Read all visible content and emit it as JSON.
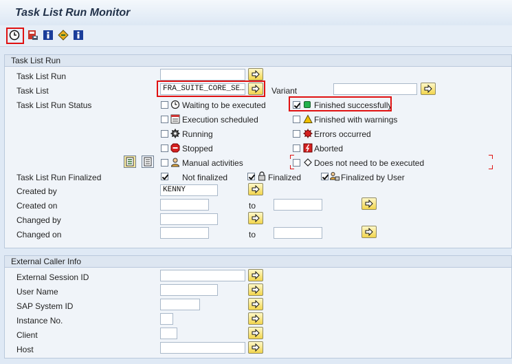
{
  "title": "Task List Run Monitor",
  "colors": {
    "highlight": "#e01010",
    "success": "#22b14c",
    "error": "#d42020",
    "warning": "#f0c000"
  },
  "toolbar": {
    "icons": [
      "clock-execute-icon",
      "save-variant-icon",
      "info-icon",
      "nav-icon",
      "info-icon-2"
    ]
  },
  "task_list_run_group": {
    "title": "Task List Run",
    "labels": {
      "task_list_run": "Task List Run",
      "task_list": "Task List",
      "status": "Task List Run Status",
      "finalized": "Task List Run Finalized",
      "created_by": "Created by",
      "created_on": "Created on",
      "changed_by": "Changed by",
      "changed_on": "Changed on"
    },
    "task_list_value": "FRA_SUITE_CORE_SE…",
    "variant_label": "Variant",
    "statuses_left": [
      {
        "label": "Waiting to be executed",
        "icon": "clock-icon"
      },
      {
        "label": "Execution scheduled",
        "icon": "schedule-icon"
      },
      {
        "label": "Running",
        "icon": "gear-icon"
      },
      {
        "label": "Stopped",
        "icon": "stop-icon"
      },
      {
        "label": "Manual activities",
        "icon": "person-icon"
      }
    ],
    "statuses_right": [
      {
        "label": "Finished successfully",
        "icon": "green-square-icon",
        "checked": true
      },
      {
        "label": "Finished with warnings",
        "icon": "warning-triangle-icon",
        "checked": false
      },
      {
        "label": "Errors occurred",
        "icon": "error-icon",
        "checked": false
      },
      {
        "label": "Aborted",
        "icon": "aborted-icon",
        "checked": false
      },
      {
        "label": "Does not need to be executed",
        "icon": "diamond-icon",
        "checked": false
      }
    ],
    "finalized_options": [
      {
        "label": "Not finalized",
        "checked": true
      },
      {
        "label": "Finalized",
        "checked": true
      },
      {
        "label": "Finalized by User",
        "checked": true
      }
    ],
    "created_by_value": "KENNY",
    "to_label": "to"
  },
  "external_caller_group": {
    "title": "External Caller Info",
    "labels": {
      "session": "External Session ID",
      "user": "User Name",
      "system": "SAP System ID",
      "instance": "Instance No.",
      "client": "Client",
      "host": "Host"
    }
  }
}
